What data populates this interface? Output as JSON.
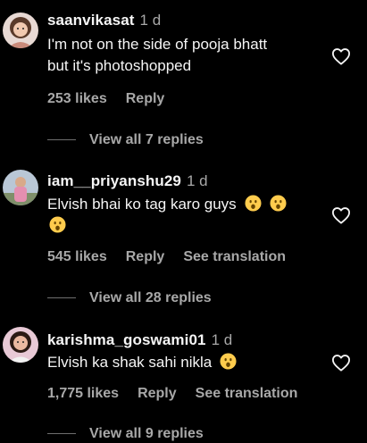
{
  "comments": [
    {
      "username": "saanvikasat",
      "time": "1 d",
      "text_lines": [
        "I'm not on the side of pooja bhatt",
        "but it's photoshopped"
      ],
      "likes": "253 likes",
      "reply": "Reply",
      "translation": "",
      "view_replies": "View all 7 replies"
    },
    {
      "username": "iam__priyanshu29",
      "time": "1 d",
      "text_lines": [
        "Elvish bhai ko tag karo guys"
      ],
      "likes": "545 likes",
      "reply": "Reply",
      "translation": "See translation",
      "view_replies": "View all 28 replies"
    },
    {
      "username": "karishma_goswami01",
      "time": "1 d",
      "text_lines": [
        "Elvish ka shak sahi nikla"
      ],
      "likes": "1,775 likes",
      "reply": "Reply",
      "translation": "See translation",
      "view_replies": "View all 9 replies"
    }
  ],
  "icons": {
    "emoji": "hushed-face-emoji-icon",
    "like": "heart-outline-icon"
  },
  "colors": {
    "background": "#000000",
    "primary_text": "#f5f5f5",
    "secondary_text": "#a8a8a8",
    "emoji": "#ffcc4d"
  }
}
